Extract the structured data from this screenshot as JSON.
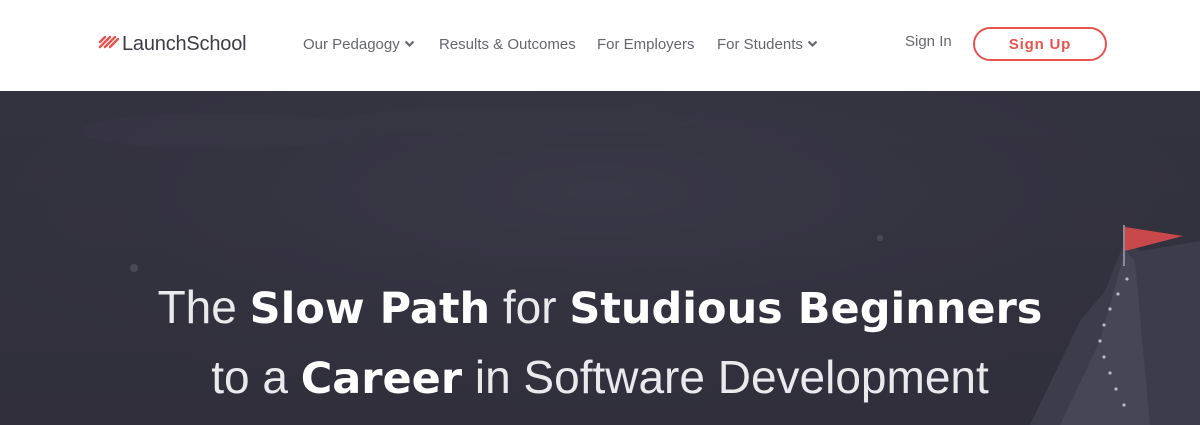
{
  "brand": {
    "name": "LaunchSchool",
    "accent_color": "#e8534f",
    "logo_icon": "stripes-logo-icon"
  },
  "nav": {
    "items": [
      {
        "label": "Our Pedagogy",
        "has_dropdown": true
      },
      {
        "label": "Results & Outcomes",
        "has_dropdown": false
      },
      {
        "label": "For Employers",
        "has_dropdown": false
      },
      {
        "label": "For Students",
        "has_dropdown": true
      }
    ],
    "sign_in_label": "Sign In",
    "sign_up_label": "Sign Up"
  },
  "hero": {
    "background_color": "#32313e",
    "line1": {
      "part1": "The ",
      "part2": "Slow Path",
      "part3": " for ",
      "part4": "Studious Beginners"
    },
    "line2": {
      "part1": "to a ",
      "part2": "Career",
      "part3": " in Software Development"
    }
  }
}
